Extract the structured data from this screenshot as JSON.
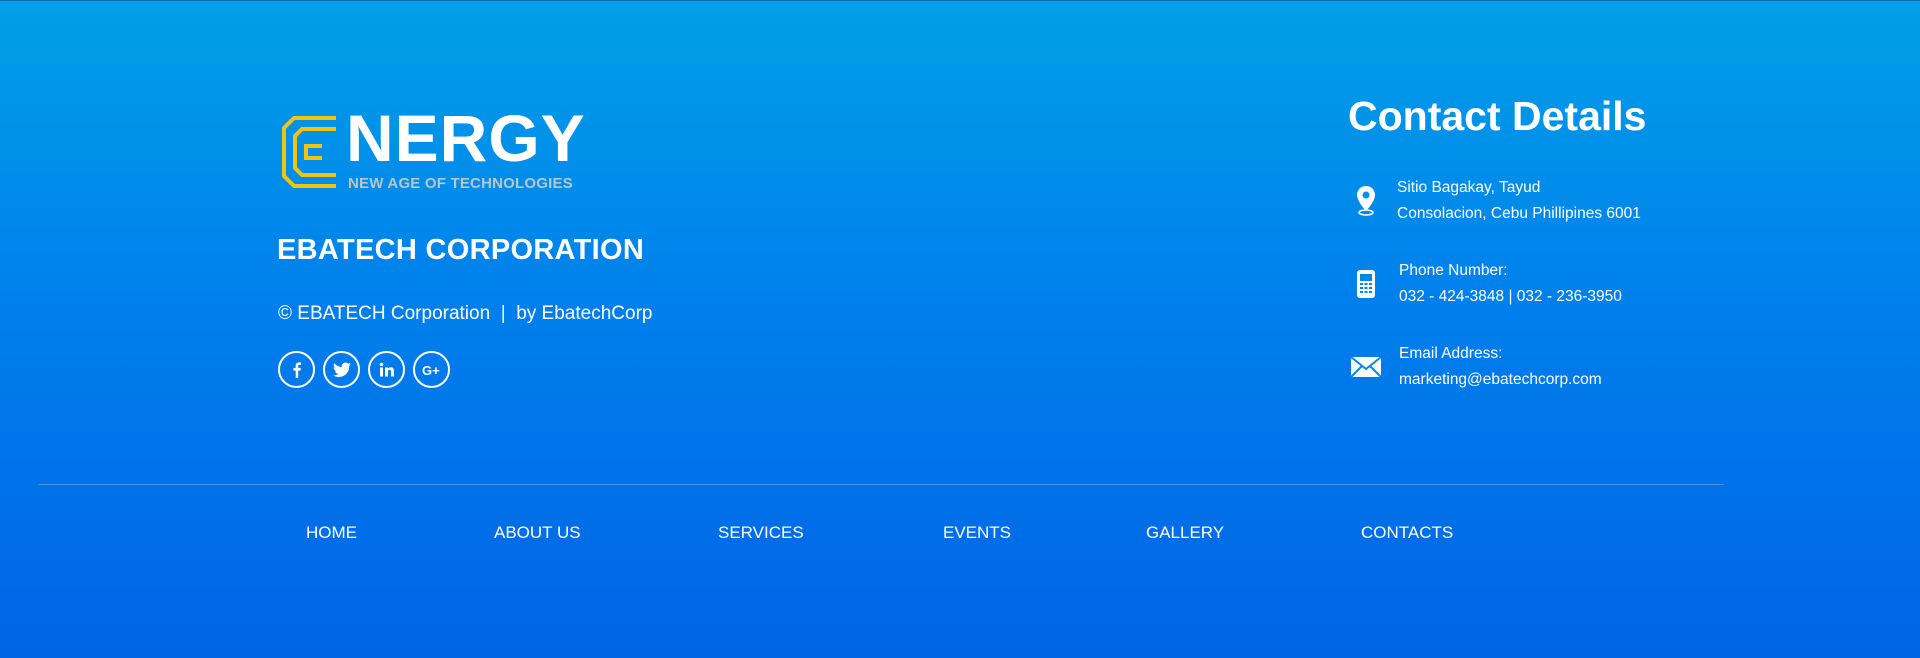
{
  "logo": {
    "wordmark": "NERGY",
    "tagline": "NEW AGE OF TECHNOLOGIES",
    "accent_color": "#f2c40f"
  },
  "company": {
    "name": "EBATECH CORPORATION",
    "copyright": "© EBATECH Corporation  |  by EbatechCorp"
  },
  "socials": [
    {
      "name": "facebook",
      "icon": "facebook-icon"
    },
    {
      "name": "twitter",
      "icon": "twitter-icon"
    },
    {
      "name": "linkedin",
      "icon": "linkedin-icon"
    },
    {
      "name": "google-plus",
      "icon": "google-plus-icon"
    }
  ],
  "contact": {
    "title": "Contact Details",
    "address": {
      "icon": "location-pin-icon",
      "line1": "Sitio Bagakay, Tayud",
      "line2": "Consolacion, Cebu Phillipines 6001"
    },
    "phone": {
      "icon": "mobile-phone-icon",
      "label": "Phone Number:",
      "value": "032 - 424-3848 | 032 - 236-3950"
    },
    "email": {
      "icon": "envelope-icon",
      "label": "Email Address:",
      "value": "marketing@ebatechcorp.com"
    }
  },
  "nav": [
    {
      "label": "HOME"
    },
    {
      "label": "ABOUT US"
    },
    {
      "label": "SERVICES"
    },
    {
      "label": "EVENTS"
    },
    {
      "label": "GALLERY"
    },
    {
      "label": "CONTACTS"
    }
  ],
  "colors": {
    "background_top": "#00a0e6",
    "background_bottom": "#0064e6",
    "text": "#ffffff"
  }
}
